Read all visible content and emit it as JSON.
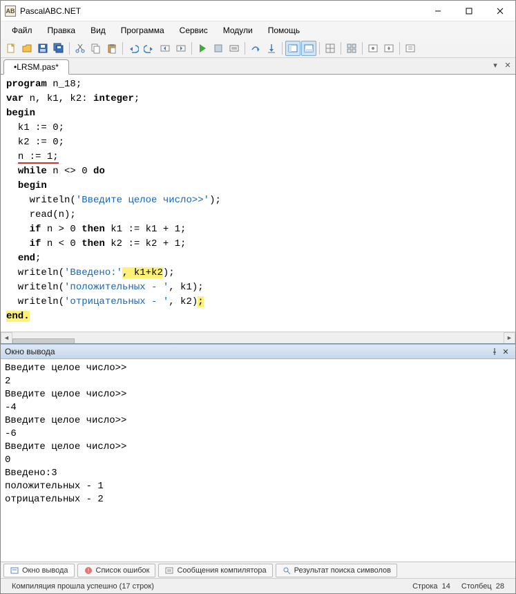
{
  "window": {
    "title": "PascalABC.NET"
  },
  "menu": {
    "items": [
      "Файл",
      "Правка",
      "Вид",
      "Программа",
      "Сервис",
      "Модули",
      "Помощь"
    ]
  },
  "tabs": {
    "active": "•LRSM.pas*"
  },
  "code": {
    "lines": [
      {
        "t": [
          [
            "kw",
            "program"
          ],
          [
            "",
            " n_18;"
          ]
        ]
      },
      {
        "t": [
          [
            "kw",
            "var"
          ],
          [
            "",
            " n, k1, k2: "
          ],
          [
            "kw",
            "integer"
          ],
          [
            "",
            ";"
          ]
        ]
      },
      {
        "t": [
          [
            "kw",
            "begin"
          ]
        ]
      },
      {
        "t": [
          [
            "",
            "  k1 := 0;"
          ]
        ]
      },
      {
        "t": [
          [
            "",
            "  k2 := 0;"
          ]
        ]
      },
      {
        "t": [
          [
            "",
            "  "
          ],
          [
            "red",
            "n := 1;"
          ]
        ]
      },
      {
        "t": [
          [
            "",
            "  "
          ],
          [
            "kw",
            "while"
          ],
          [
            "",
            " n <> 0 "
          ],
          [
            "kw",
            "do"
          ]
        ]
      },
      {
        "t": [
          [
            "",
            "  "
          ],
          [
            "kw",
            "begin"
          ]
        ]
      },
      {
        "t": [
          [
            "",
            "    writeln("
          ],
          [
            "str",
            "'Введите целое число>>'"
          ],
          [
            "",
            ");"
          ]
        ]
      },
      {
        "t": [
          [
            "",
            "    read(n);"
          ]
        ]
      },
      {
        "t": [
          [
            "",
            "    "
          ],
          [
            "kw",
            "if"
          ],
          [
            "",
            " n > 0 "
          ],
          [
            "kw",
            "then"
          ],
          [
            "",
            " k1 := k1 + 1;"
          ]
        ]
      },
      {
        "t": [
          [
            "",
            "    "
          ],
          [
            "kw",
            "if"
          ],
          [
            "",
            " n < 0 "
          ],
          [
            "kw",
            "then"
          ],
          [
            "",
            " k2 := k2 + 1;"
          ]
        ]
      },
      {
        "t": [
          [
            "",
            "  "
          ],
          [
            "kw",
            "end"
          ],
          [
            "",
            ";"
          ]
        ]
      },
      {
        "t": [
          [
            "",
            "  writeln("
          ],
          [
            "str",
            "'Введено:'"
          ],
          [
            "hl",
            ", k1+k2"
          ],
          [
            "",
            ");"
          ]
        ]
      },
      {
        "t": [
          [
            "",
            "  writeln("
          ],
          [
            "str",
            "'положительных - '"
          ],
          [
            "",
            ", k1);"
          ]
        ]
      },
      {
        "t": [
          [
            "",
            "  writeln("
          ],
          [
            "str",
            "'отрицательных - '"
          ],
          [
            "",
            ", k2)"
          ],
          [
            "hl",
            ";"
          ]
        ]
      },
      {
        "t": [
          [
            "hlkw",
            "end."
          ]
        ]
      }
    ]
  },
  "output_panel": {
    "title": "Окно вывода",
    "text": "Введите целое число>>\n2\nВведите целое число>>\n-4\nВведите целое число>>\n-6\nВведите целое число>>\n0\nВведено:3\nположительных - 1\nотрицательных - 2"
  },
  "bottom_tabs": {
    "items": [
      {
        "label": "Окно вывода",
        "active": true,
        "icon": "output"
      },
      {
        "label": "Список ошибок",
        "active": false,
        "icon": "errors"
      },
      {
        "label": "Сообщения компилятора",
        "active": false,
        "icon": "msgs"
      },
      {
        "label": "Результат поиска символов",
        "active": false,
        "icon": "search"
      }
    ]
  },
  "status": {
    "left": "Компиляция прошла успешно (17 строк)",
    "line_label": "Строка",
    "line_val": "14",
    "col_label": "Столбец",
    "col_val": "28"
  }
}
